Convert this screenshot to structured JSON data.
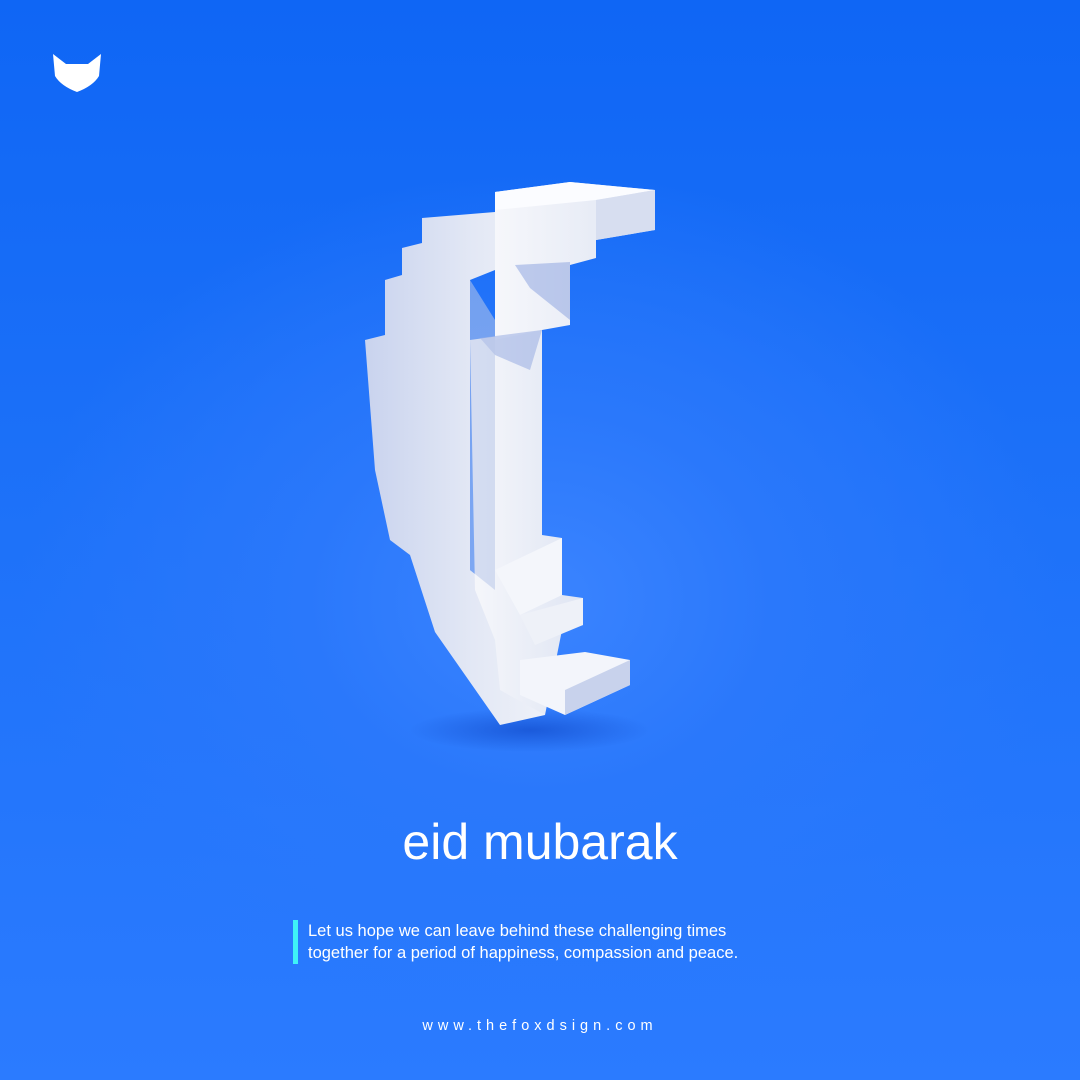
{
  "brand": {
    "logo_icon": "fox-head-icon"
  },
  "artwork": {
    "icon": "crescent-moon-icon"
  },
  "title": "eid mubarak",
  "message": {
    "line1": "Let us hope we can leave behind these challenging times",
    "line2": "together for a period of happiness, compassion and peace.",
    "accent_color": "#3ff2f7"
  },
  "website": "www.thefoxdsign.com",
  "colors": {
    "background": "#1a6ff7",
    "text": "#ffffff"
  }
}
